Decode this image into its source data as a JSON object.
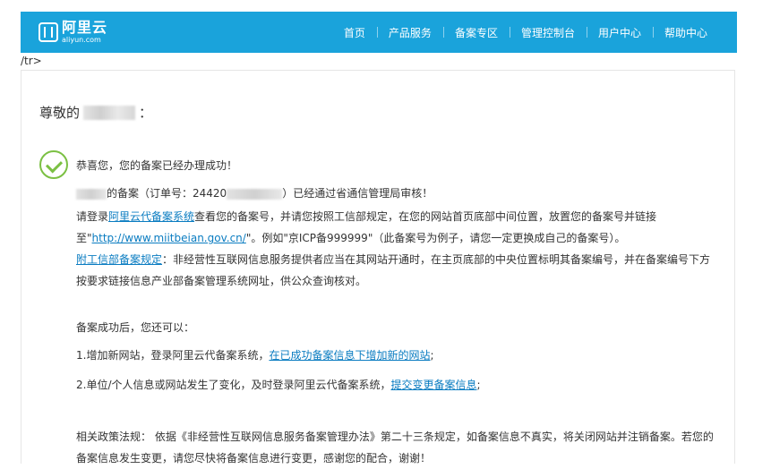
{
  "header": {
    "logo_name": "阿里云",
    "logo_domain": "aliyun.com",
    "nav": [
      "首页",
      "产品服务",
      "备案专区",
      "管理控制台",
      "用户中心",
      "帮助中心"
    ]
  },
  "stray_text": "/tr>",
  "greeting": {
    "prefix": "尊敬的",
    "suffix": "："
  },
  "success_text": "恭喜您，您的备案已经办理成功！",
  "record_line": {
    "part1": "的备案（订单号：24420",
    "part2": "）已经通过省通信管理局审核！"
  },
  "para1": {
    "a": "请登录",
    "link": "阿里云代备案系统",
    "b": "查看您的备案号，并请您按照工信部规定，在您的网站首页底部中间位置，放置您的备案号并链接",
    "c": "至\"",
    "url": "http://www.miitbeian.gov.cn/",
    "d": "\"。例如\"京ICP备999999\"（此备案号为例子，请您一定更换成自己的备案号）。"
  },
  "para2": {
    "link": "附工信部备案规定",
    "a": "：非经营性互联网信息服务提供者应当在其网站开通时，在主页底部的中央位置标明其备案编号，并在备案编号下方",
    "b": "按要求链接信息产业部备案管理系统网址，供公众查询核对。"
  },
  "after": {
    "intro": "备案成功后，您还可以：",
    "item1_text": "1.增加新网站，登录阿里云代备案系统，",
    "item1_link": "在已成功备案信息下增加新的网站",
    "item1_end": ";",
    "item2_text": "2.单位/个人信息或网站发生了变化，及时登录阿里云代备案系统，",
    "item2_link": "提交变更备案信息",
    "item2_end": ";"
  },
  "policy": {
    "line1": "相关政策法规：  依据《非经营性互联网信息服务备案管理办法》第二十三条规定，如备案信息不真实，将关闭网站并注销备案。若您的",
    "line2": "备案信息发生变更，请您尽快将备案信息进行变更，感谢您的配合，谢谢！"
  },
  "colors": {
    "header_bg": "#1aa3db",
    "link": "#0a7cc1",
    "check": "#7bc043"
  }
}
